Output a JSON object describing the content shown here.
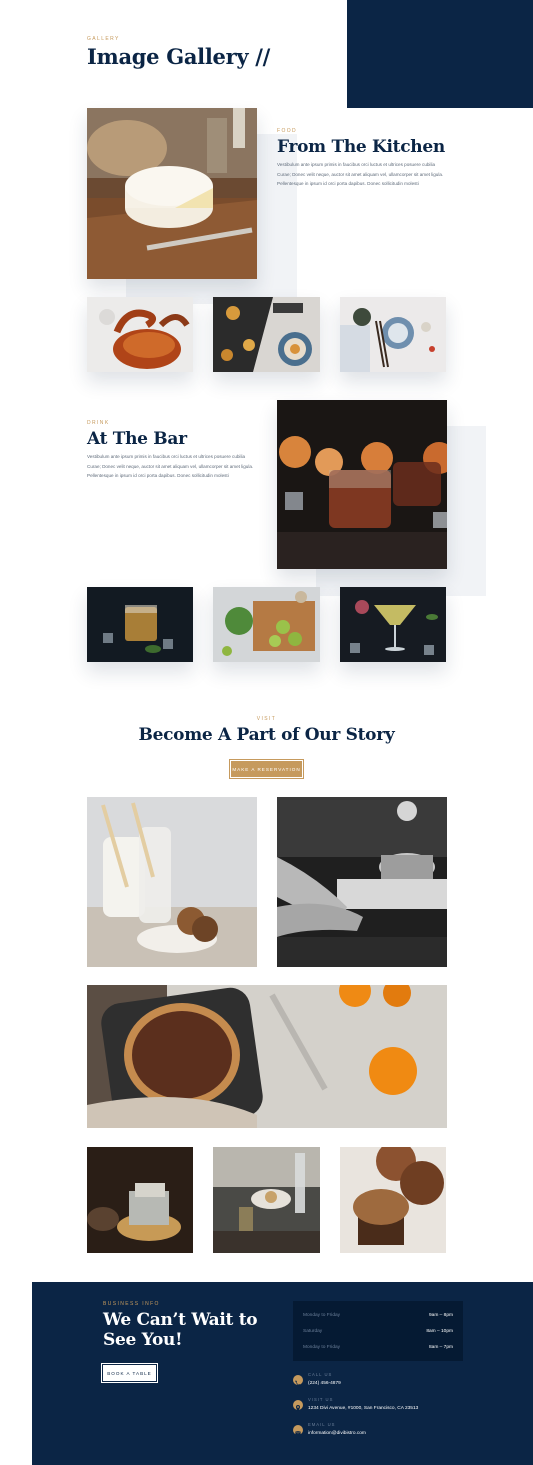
{
  "gallery": {
    "eyebrow": "GALLERY",
    "title": "Image Gallery //"
  },
  "kitchen": {
    "eyebrow": "FOOD",
    "title": "From The Kitchen",
    "body": "Vestibulum ante ipsum primis in faucibus orci luctus et ultrices posuere cubilia Curae; Donec velit neque, auctor sit amet aliquam vel, ullamcorper sit amet ligula. Pellentesque in ipsum id orci porta dapibus. Donec sollicitudin molesti"
  },
  "bar": {
    "eyebrow": "DRINK",
    "title": "At The Bar",
    "body": "Vestibulum ante ipsum primis in faucibus orci luctus et ultrices posuere cubilia Curae; Donec velit neque, auctor sit amet aliquam vel, ullamcorper sit amet ligula. Pellentesque in ipsum id orci porta dapibus. Donec sollicitudin molesti"
  },
  "visit": {
    "eyebrow": "VISIT",
    "title": "Become A Part of Our Story",
    "button": "MAKE A RESERVATION"
  },
  "footer": {
    "eyebrow": "BUSINESS INFO",
    "title_line1": "We Can’t Wait to",
    "title_line2": "See You!",
    "button": "BOOK A TABLE",
    "hours": [
      {
        "day": "Monday to Friday",
        "time": "9am – 8pm"
      },
      {
        "day": "Saturday",
        "time": "8am – 10pm"
      },
      {
        "day": "Monday to Friday",
        "time": "8am – 7pm"
      }
    ],
    "contacts": [
      {
        "icon": "phone-icon",
        "label": "CALL US",
        "value": "(224) 456-4879"
      },
      {
        "icon": "location-pin-icon",
        "label": "VISIT US",
        "value": "1234 Divi Avenue, #1000, San Francisco, CA 23513"
      },
      {
        "icon": "email-icon",
        "label": "EMAIL US",
        "value": "information@divibistro.com"
      }
    ]
  },
  "colors": {
    "navy": "#0b2545",
    "gold": "#c69a5d",
    "panel": "#051a33"
  }
}
